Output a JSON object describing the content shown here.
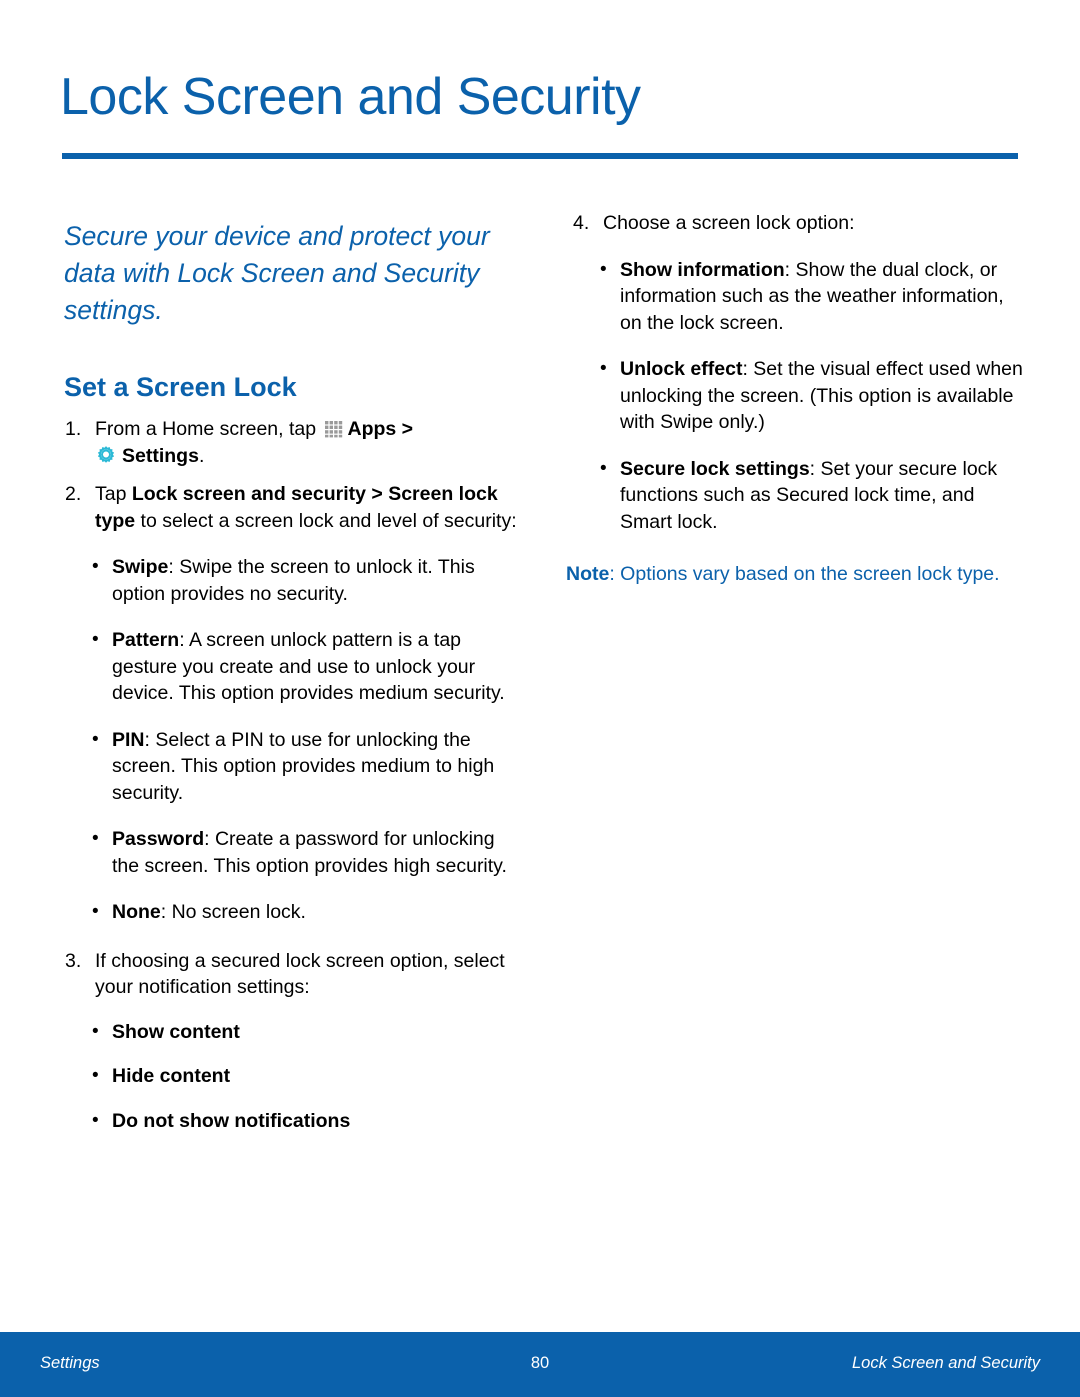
{
  "page": {
    "title": "Lock Screen and Security",
    "accent_color": "#0b61ab",
    "settings_icon_color": "#2bb9d6"
  },
  "left_column": {
    "intro": "Secure your device and protect your data with Lock Screen and Security settings.",
    "section_heading": "Set a Screen Lock",
    "steps": [
      {
        "number": "1.",
        "text_before_apps_icon": "From a Home screen, tap ",
        "apps_label": "Apps",
        "separator": " > ",
        "settings_label": "Settings",
        "text_after": "."
      },
      {
        "number": "2.",
        "lead": "Tap ",
        "bold_1": "Lock screen and security",
        "mid": " > ",
        "bold_2": "Screen lock type",
        "tail": " to select a screen lock and level of security:"
      },
      {
        "number": "3.",
        "text": "If choosing a secured lock screen option, select your notification settings:"
      }
    ],
    "lock_type_bullets": [
      {
        "term": "Swipe",
        "desc": ": Swipe the screen to unlock it. This option provides no security."
      },
      {
        "term": "Pattern",
        "desc": ": A screen unlock pattern is a tap gesture you create and use to unlock your device. This option provides medium security."
      },
      {
        "term": "PIN",
        "desc": ": Select a PIN to use for unlocking the screen. This option provides medium to high security."
      },
      {
        "term": "Password",
        "desc": ": Create a password for unlocking the screen. This option provides high security."
      },
      {
        "term": "None",
        "desc": ": No screen lock."
      }
    ],
    "notification_bullets": [
      {
        "term": "Show content",
        "desc": ""
      },
      {
        "term": "Hide content",
        "desc": ""
      },
      {
        "term": "Do not show notifications",
        "desc": ""
      }
    ]
  },
  "right_column": {
    "step": {
      "number": "4.",
      "text": "Choose a screen lock option:"
    },
    "option_bullets": [
      {
        "term": "Show information",
        "desc": ": Show the dual clock, or information such as the weather information, on the lock screen."
      },
      {
        "term": "Unlock effect",
        "desc": ": Set the visual effect used when unlocking the screen. (This option is available with Swipe only.)"
      },
      {
        "term": "Secure lock settings",
        "desc": ": Set your secure lock functions such as Secured lock time, and Smart lock."
      }
    ],
    "note": {
      "label": "Note",
      "text": ": Options vary based on the screen lock type."
    }
  },
  "footer": {
    "left": "Settings",
    "center": "80",
    "right": "Lock Screen and Security"
  },
  "icons": {
    "apps": "apps-grid-icon",
    "settings": "settings-gear-icon"
  }
}
